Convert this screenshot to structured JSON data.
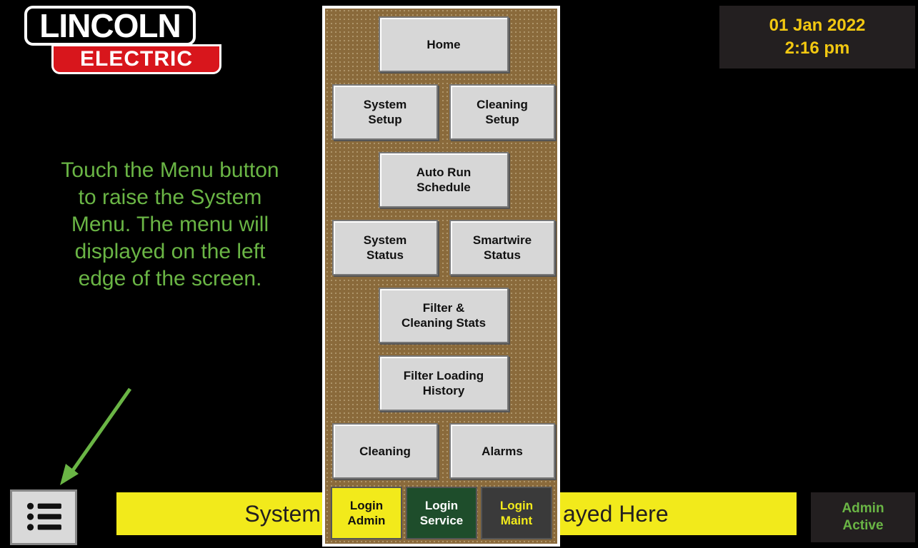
{
  "logo": {
    "line1": "LINCOLN",
    "line2": "ELECTRIC"
  },
  "datetime": {
    "date": "01 Jan 2022",
    "time": "2:16 pm"
  },
  "instruction": "Touch the Menu button to raise the System Menu. The menu will displayed on the left edge of the screen.",
  "status_banner": {
    "text_left": "System ",
    "text_right": "ayed Here"
  },
  "admin_status": {
    "line1": "Admin",
    "line2": "Active"
  },
  "menu_button": {
    "icon": "hamburger-list-icon"
  },
  "menu": {
    "home": "Home",
    "system_setup": "System\nSetup",
    "cleaning_setup": "Cleaning\nSetup",
    "auto_run_schedule": "Auto Run\nSchedule",
    "system_status": "System\nStatus",
    "smartwire_status": "Smartwire\nStatus",
    "filter_cleaning_stats": "Filter &\nCleaning Stats",
    "filter_loading_history": "Filter Loading\nHistory",
    "cleaning": "Cleaning",
    "alarms": "Alarms",
    "login_admin": "Login\nAdmin",
    "login_service": "Login\nService",
    "login_maint": "Login\nMaint"
  },
  "colors": {
    "banner": "#f2ea1b",
    "instruction_text": "#6ab545",
    "date_text": "#f2c811",
    "menu_background": "#8a6a3b",
    "login_admin_bg": "#f2ea1b",
    "login_service_bg": "#1e4d2b",
    "login_maint_bg": "#3a3a3a"
  }
}
